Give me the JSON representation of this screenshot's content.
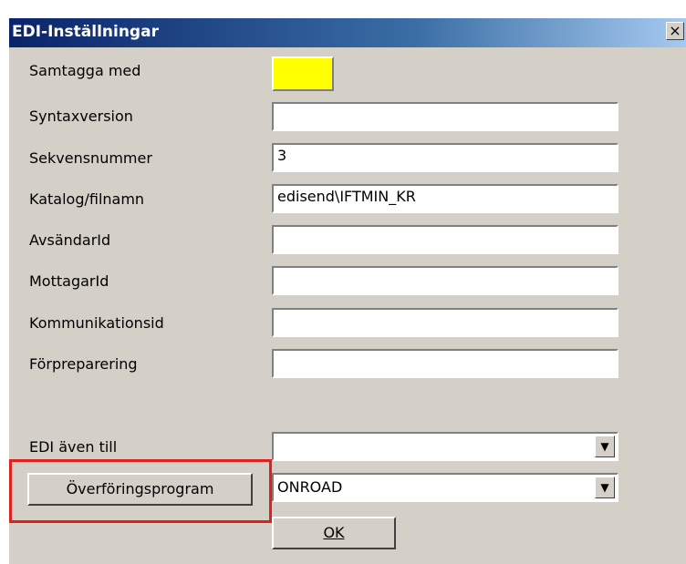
{
  "window": {
    "title": "EDI-Inställningar",
    "close_label": "×"
  },
  "fields": [
    {
      "label": "Samtagga med",
      "value": "",
      "type": "color"
    },
    {
      "label": "Syntaxversion",
      "value": ""
    },
    {
      "label": "Sekvensnummer",
      "value": "3"
    },
    {
      "label": "Katalog/filnamn",
      "value": "edisend\\IFTMIN_KR"
    },
    {
      "label": "AvsändarId",
      "value": ""
    },
    {
      "label": "MottagarId",
      "value": ""
    },
    {
      "label": "Kommunikationsid",
      "value": ""
    },
    {
      "label": "Förpreparering",
      "value": ""
    }
  ],
  "edi_also": {
    "label": "EDI även till",
    "value": ""
  },
  "transfer": {
    "button_label": "Överföringsprogram",
    "value": "ONROAD"
  },
  "ok_label": "OK",
  "colors": {
    "swatch": "#ffff00",
    "highlight": "#e02020"
  }
}
